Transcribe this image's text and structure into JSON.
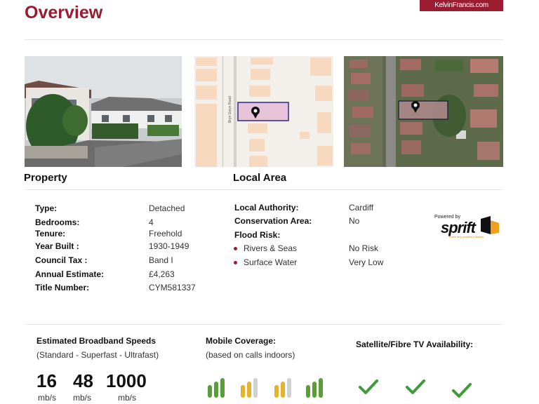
{
  "header": {
    "title": "Overview",
    "brand": "KelvinFrancis.com"
  },
  "map": {
    "road_label": "Bryn Gwyn Road"
  },
  "property": {
    "heading": "Property",
    "rows": [
      {
        "label": "Type:",
        "value": "Detached"
      },
      {
        "label": "Bedrooms:",
        "value": "4"
      },
      {
        "label": "Tenure:",
        "value": "Freehold"
      },
      {
        "label": "Year Built :",
        "value": "1930-1949"
      },
      {
        "label": "Council Tax :",
        "value": "Band I"
      },
      {
        "label": "Annual Estimate:",
        "value": "£4,263"
      },
      {
        "label": "Title Number:",
        "value": "CYM581337"
      }
    ]
  },
  "local_area": {
    "heading": "Local Area",
    "authority_label": "Local Authority:",
    "authority_value": "Cardiff",
    "conservation_label": "Conservation Area:",
    "conservation_value": "No",
    "flood_label": "Flood Risk:",
    "flood_items": [
      {
        "label": "Rivers & Seas",
        "value": "No Risk"
      },
      {
        "label": "Surface Water",
        "value": "Very Low"
      }
    ],
    "powered_by": "Powered by",
    "sprift_name": "sprift",
    "sprift_tagline": "Know any property instantly"
  },
  "broadband": {
    "heading": "Estimated Broadband Speeds",
    "subheading": "(Standard - Superfast - Ultrafast)",
    "speeds": [
      {
        "value": "16",
        "unit": "mb/s"
      },
      {
        "value": "48",
        "unit": "mb/s"
      },
      {
        "value": "1000",
        "unit": "mb/s"
      }
    ]
  },
  "mobile": {
    "heading": "Mobile Coverage:",
    "subheading": "(based on calls indoors)",
    "signals": [
      {
        "bars_filled": 3,
        "color": "#5a9e3a"
      },
      {
        "bars_filled": 2,
        "color": "#e8b030"
      },
      {
        "bars_filled": 2,
        "color": "#e8b030"
      },
      {
        "bars_filled": 3,
        "color": "#5a9e3a"
      }
    ]
  },
  "satellite": {
    "heading": "Satellite/Fibre TV Availability:",
    "ticks": [
      "check-icon",
      "check-icon",
      "check-icon"
    ],
    "tick_color": "#3f9a3a"
  },
  "colors": {
    "accent": "#9b1b30",
    "signal_empty": "#d0d0d0"
  }
}
